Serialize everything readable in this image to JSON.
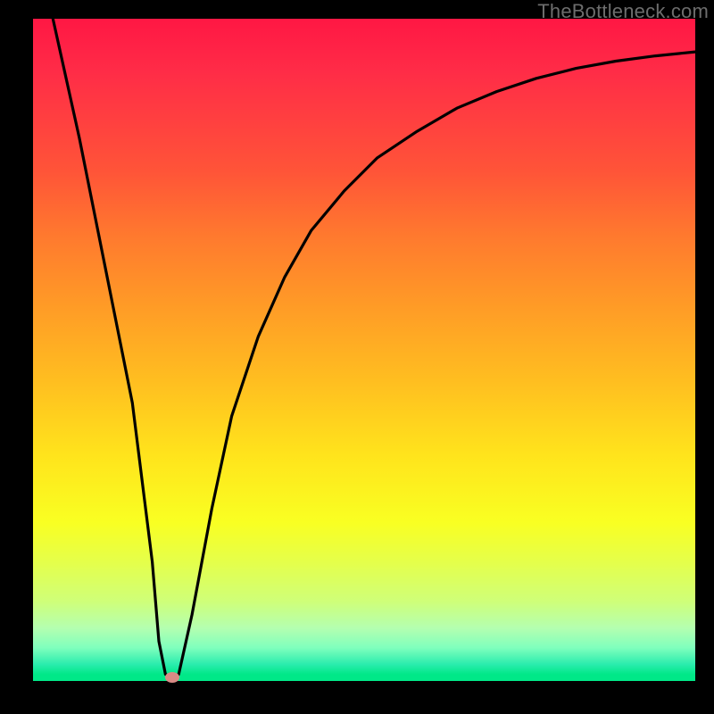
{
  "watermark": "TheBottleneck.com",
  "chart_data": {
    "type": "line",
    "title": "",
    "xlabel": "",
    "ylabel": "",
    "xlim": [
      0,
      100
    ],
    "ylim": [
      0,
      100
    ],
    "series": [
      {
        "name": "curve",
        "x": [
          3,
          7,
          11,
          15,
          18,
          19,
          20,
          21,
          22,
          24,
          27,
          30,
          34,
          38,
          42,
          47,
          52,
          58,
          64,
          70,
          76,
          82,
          88,
          94,
          100
        ],
        "y": [
          100,
          82,
          62,
          42,
          18,
          6,
          1,
          0.5,
          1,
          10,
          26,
          40,
          52,
          61,
          68,
          74,
          79,
          83,
          86.5,
          89,
          91,
          92.5,
          93.6,
          94.4,
          95
        ]
      }
    ],
    "marker": {
      "x": 21,
      "y": 0.5
    },
    "background_gradient": {
      "top": "#ff1744",
      "mid": "#ffe41c",
      "bottom": "#00e888"
    },
    "colors": {
      "frame": "#000000",
      "curve": "#000000",
      "marker": "#d88a85",
      "watermark": "#6d6d6d"
    }
  }
}
